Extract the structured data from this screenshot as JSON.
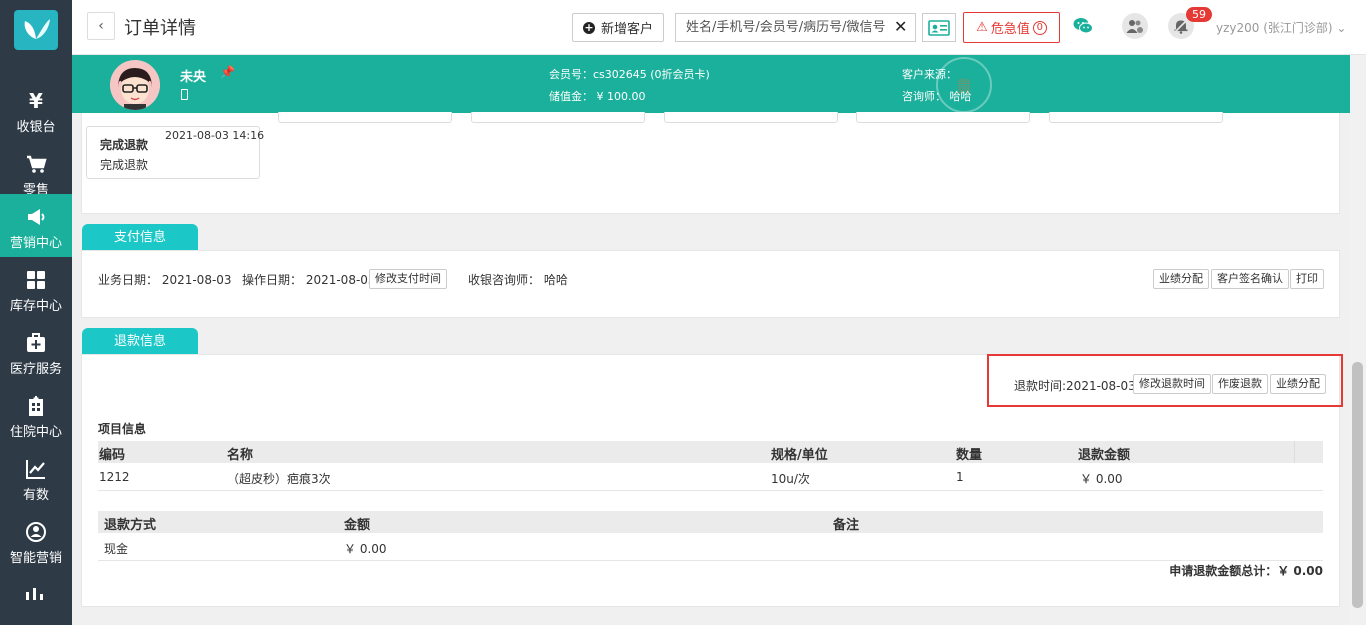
{
  "sidebar": {
    "items": [
      {
        "label": "收银台",
        "icon": "yen-icon"
      },
      {
        "label": "零售",
        "icon": "cart-icon"
      },
      {
        "label": "营销中心",
        "icon": "megaphone-icon",
        "active": true
      },
      {
        "label": "库存中心",
        "icon": "grid-icon"
      },
      {
        "label": "医疗服务",
        "icon": "medical-kit-icon"
      },
      {
        "label": "住院中心",
        "icon": "hospital-icon"
      },
      {
        "label": "有数",
        "icon": "trend-chart-icon"
      },
      {
        "label": "智能营销",
        "icon": "smart-marketing-icon"
      }
    ]
  },
  "header": {
    "back_icon": "‹",
    "title": "订单详情",
    "new_customer_label": "新增客户",
    "search_placeholder": "姓名/手机号/会员号/病历号/微信号",
    "search_clear": "✕",
    "alert_label": "危急值",
    "alert_count": "0",
    "notify_count": "59",
    "user": "yzy200 (张江门诊部) ⌄"
  },
  "customer": {
    "name": "未央",
    "member_no": "会员号：cs302645 (0折会员卡)",
    "balance": "储值金： ¥ 100.00",
    "source": "客户来源：",
    "consultant": "咨询师： 哈哈",
    "stamp": "貴"
  },
  "progress": {
    "step_title": "完成退款",
    "step_time": "2021-08-03 14:16",
    "step_desc": "完成退款"
  },
  "payment": {
    "tab": "支付信息",
    "business_date": "业务日期：  2021-08-03",
    "operate_date": "操作日期： 2021-08-03",
    "edit_time_btn": "修改支付时间",
    "cashier_consultant": "收银咨询师：  哈哈",
    "perf_btn": "业绩分配",
    "sign_btn": "客户签名确认",
    "print_btn": "打印"
  },
  "refund": {
    "tab": "退款信息",
    "refund_time": "退款时间:2021-08-03",
    "edit_refund_time_btn": "修改退款时间",
    "void_btn": "作废退款",
    "perf_btn": "业绩分配",
    "items_title": "项目信息",
    "items_headers": [
      "编码",
      "名称",
      "规格/单位",
      "数量",
      "退款金额"
    ],
    "items_rows": [
      [
        "1212",
        "（超皮秒）疤痕3次",
        "10u/次",
        "1",
        "￥ 0.00"
      ]
    ],
    "method_headers": [
      "退款方式",
      "金额",
      "备注"
    ],
    "method_rows": [
      [
        "现金",
        "￥ 0.00",
        ""
      ]
    ],
    "total": "申请退款金额总计：￥ 0.00"
  }
}
